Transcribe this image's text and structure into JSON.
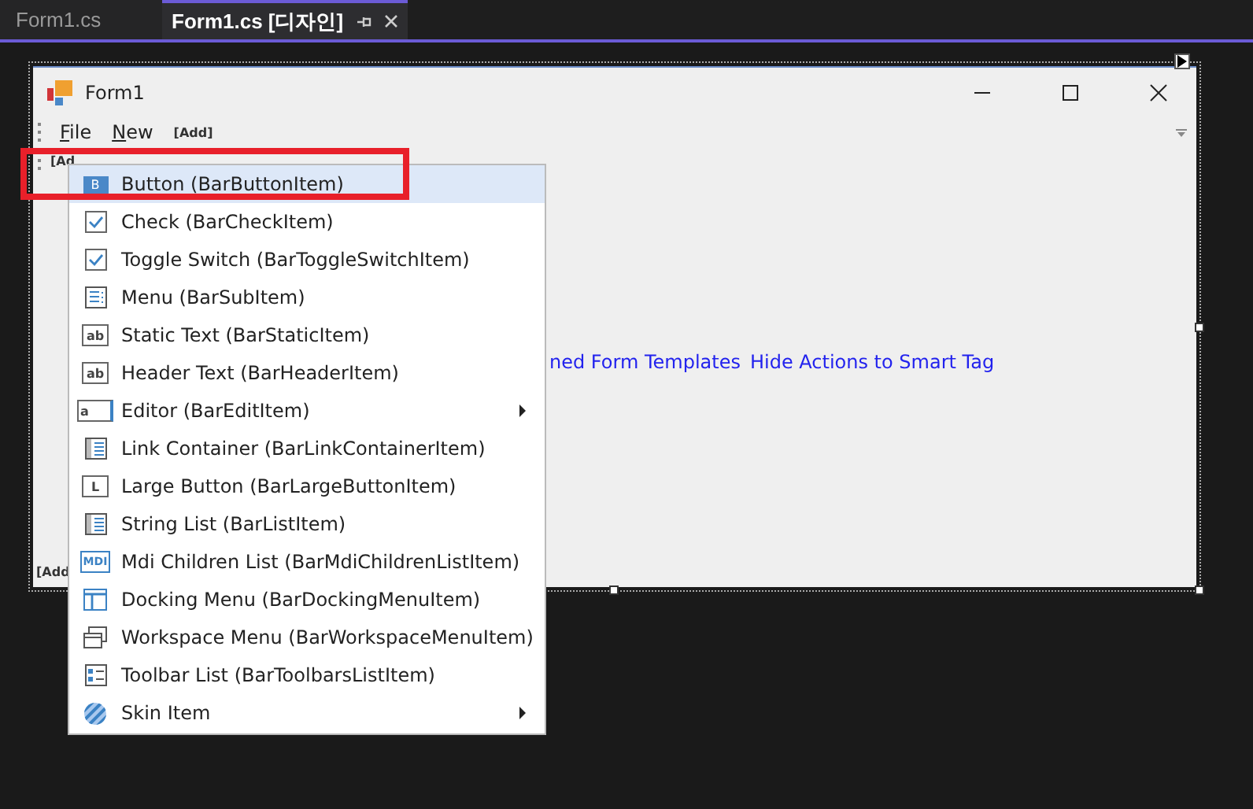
{
  "tabs": [
    {
      "label": "Form1.cs",
      "selected": false
    },
    {
      "label": "Form1.cs [디자인]",
      "selected": true
    }
  ],
  "form": {
    "title": "Form1",
    "menu": [
      {
        "label": "File"
      },
      {
        "label": "New"
      }
    ],
    "menu_add": "[Add]",
    "bar2_add": "[Ad",
    "links": [
      "ned Form Templates",
      "Hide Actions to Smart Tag"
    ],
    "status_add": "[Add"
  },
  "popup": {
    "items": [
      {
        "label": "Button (BarButtonItem)",
        "kind": "button",
        "icon_text": "B",
        "submenu": false,
        "selected": true
      },
      {
        "label": "Check (BarCheckItem)",
        "kind": "check",
        "submenu": false,
        "selected": false
      },
      {
        "label": "Toggle Switch (BarToggleSwitchItem)",
        "kind": "check",
        "submenu": false,
        "selected": false
      },
      {
        "label": "Menu (BarSubItem)",
        "kind": "menu",
        "submenu": false,
        "selected": false
      },
      {
        "label": "Static Text (BarStaticItem)",
        "kind": "text",
        "icon_text": "ab",
        "submenu": false,
        "selected": false
      },
      {
        "label": "Header Text (BarHeaderItem)",
        "kind": "text",
        "icon_text": "ab",
        "submenu": false,
        "selected": false
      },
      {
        "label": "Editor (BarEditItem)",
        "kind": "editor",
        "icon_text": "a",
        "submenu": true,
        "selected": false
      },
      {
        "label": "Link Container (BarLinkContainerItem)",
        "kind": "list",
        "submenu": false,
        "selected": false
      },
      {
        "label": "Large Button (BarLargeButtonItem)",
        "kind": "large",
        "icon_text": "L",
        "submenu": false,
        "selected": false
      },
      {
        "label": "String List (BarListItem)",
        "kind": "list",
        "submenu": false,
        "selected": false
      },
      {
        "label": "Mdi Children List (BarMdiChildrenListItem)",
        "kind": "mdi",
        "icon_text": "MDI",
        "submenu": false,
        "selected": false
      },
      {
        "label": "Docking Menu (BarDockingMenuItem)",
        "kind": "docking",
        "submenu": false,
        "selected": false
      },
      {
        "label": "Workspace Menu (BarWorkspaceMenuItem)",
        "kind": "workspace",
        "submenu": false,
        "selected": false
      },
      {
        "label": "Toolbar List (BarToolbarsListItem)",
        "kind": "toolbars",
        "submenu": false,
        "selected": false
      },
      {
        "label": "Skin Item",
        "kind": "skin",
        "submenu": true,
        "selected": false
      }
    ]
  }
}
